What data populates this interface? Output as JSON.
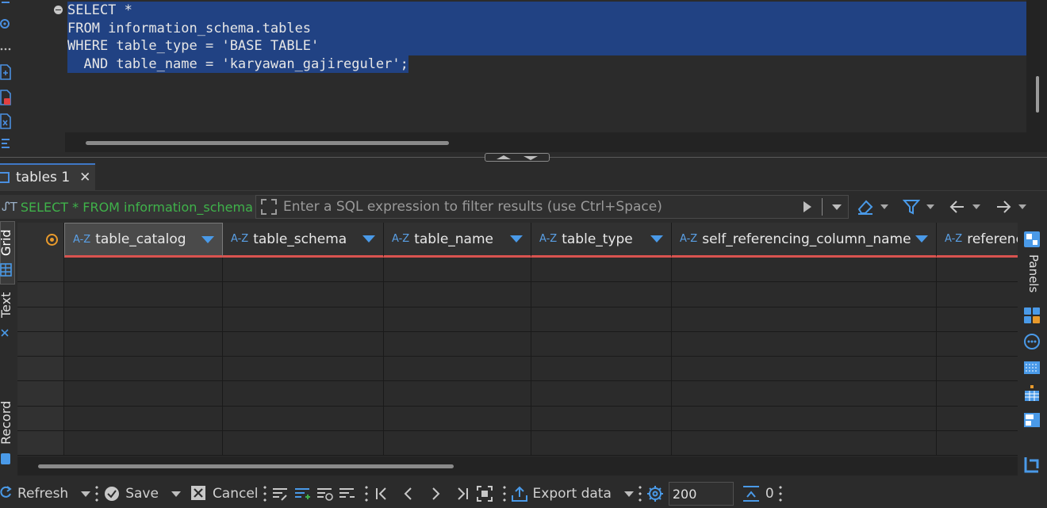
{
  "editor": {
    "lines": [
      "SELECT *",
      "FROM information_schema.tables",
      "WHERE table_type = 'BASE TABLE'",
      "  AND table_name = 'karyawan_gajireguler';"
    ]
  },
  "result_tab": {
    "label": "tables 1",
    "close": "✕"
  },
  "filter": {
    "query_preview": "SELECT * FROM information_schema",
    "placeholder": "Enter a SQL expression to filter results (use Ctrl+Space)"
  },
  "grid": {
    "columns": [
      {
        "type": "A-Z",
        "name": "table_catalog"
      },
      {
        "type": "A-Z",
        "name": "table_schema"
      },
      {
        "type": "A-Z",
        "name": "table_name"
      },
      {
        "type": "A-Z",
        "name": "table_type"
      },
      {
        "type": "A-Z",
        "name": "self_referencing_column_name"
      },
      {
        "type": "A-Z",
        "name": "referenc"
      }
    ],
    "visible_empty_rows": 8
  },
  "view_tabs": {
    "grid": "Grid",
    "text": "Text",
    "record": "Record"
  },
  "right_panel": {
    "label": "Panels"
  },
  "toolbar": {
    "refresh": "Refresh",
    "save": "Save",
    "cancel": "Cancel",
    "export": "Export data",
    "fetch_size": "200",
    "row_count": "0"
  },
  "colors": {
    "selection": "#214283",
    "query_green": "#3fb24a",
    "header_underline": "#d9534f",
    "accent_blue": "#4a9ae8",
    "orange": "#e89a2c"
  }
}
